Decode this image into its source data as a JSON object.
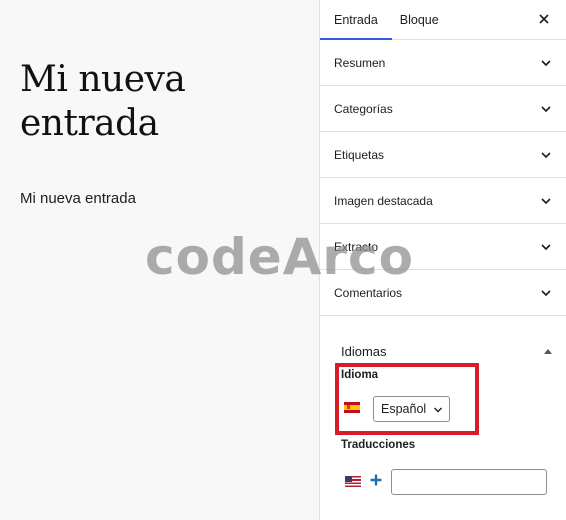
{
  "editor": {
    "title": "Mi nueva entrada",
    "paragraph": "Mi nueva entrada"
  },
  "watermark": "codeArco",
  "sidebar": {
    "tabs": [
      "Entrada",
      "Bloque"
    ],
    "active_tab": "Entrada",
    "panels": [
      "Resumen",
      "Categorías",
      "Etiquetas",
      "Imagen destacada",
      "Extracto",
      "Comentarios"
    ],
    "languages_panel": {
      "title": "Idiomas",
      "language_label": "Idioma",
      "language_value": "Español",
      "translations_label": "Traducciones",
      "translation_input_value": ""
    }
  },
  "colors": {
    "accent": "#3858e9",
    "highlight_box": "#d51f26",
    "plus": "#2271b1"
  },
  "icons": {
    "close": "close-icon",
    "chevron": "chevron-down-icon",
    "collapse": "triangle-up-icon",
    "flag_es": "flag-es-icon",
    "flag_us": "flag-us-icon",
    "add": "plus-icon"
  }
}
